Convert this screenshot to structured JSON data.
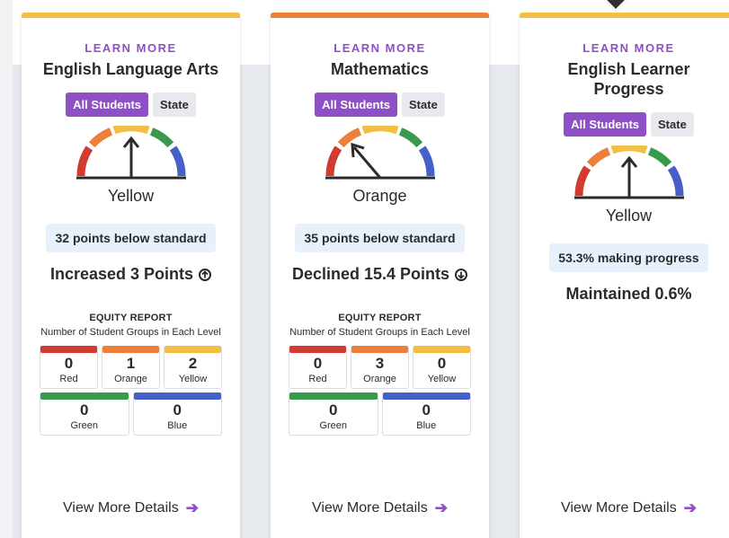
{
  "colors": {
    "red": "#d23b31",
    "orange": "#ec7f3a",
    "yellow": "#f2be43",
    "green": "#3a9a4b",
    "blue": "#4660c9",
    "purple": "#8e4fc7",
    "status_bg": "#e8f1fb"
  },
  "cards": [
    {
      "learn_more": "LEARN MORE",
      "title": "English Language Arts",
      "toggle": {
        "all_students": "All Students",
        "state": "State"
      },
      "level": "Yellow",
      "status_text": "32 points below standard",
      "change_text": "Increased 3 Points",
      "change_direction": "up",
      "equity": {
        "title": "EQUITY REPORT",
        "subtitle": "Number of Student Groups in Each Level",
        "counts": {
          "red": "0",
          "orange": "1",
          "yellow": "2",
          "green": "0",
          "blue": "0"
        },
        "labels": {
          "red": "Red",
          "orange": "Orange",
          "yellow": "Yellow",
          "green": "Green",
          "blue": "Blue"
        }
      },
      "view_more": "View More Details"
    },
    {
      "learn_more": "LEARN MORE",
      "title": "Mathematics",
      "toggle": {
        "all_students": "All Students",
        "state": "State"
      },
      "level": "Orange",
      "status_text": "35 points below standard",
      "change_text": "Declined 15.4 Points",
      "change_direction": "down",
      "equity": {
        "title": "EQUITY REPORT",
        "subtitle": "Number of Student Groups in Each Level",
        "counts": {
          "red": "0",
          "orange": "3",
          "yellow": "0",
          "green": "0",
          "blue": "0"
        },
        "labels": {
          "red": "Red",
          "orange": "Orange",
          "yellow": "Yellow",
          "green": "Green",
          "blue": "Blue"
        }
      },
      "view_more": "View More Details"
    },
    {
      "learn_more": "LEARN MORE",
      "title": "English Learner Progress",
      "toggle": {
        "all_students": "All Students",
        "state": "State"
      },
      "level": "Yellow",
      "status_text": "53.3% making progress",
      "change_text": "Maintained 0.6%",
      "change_direction": "none",
      "view_more": "View More Details"
    }
  ]
}
